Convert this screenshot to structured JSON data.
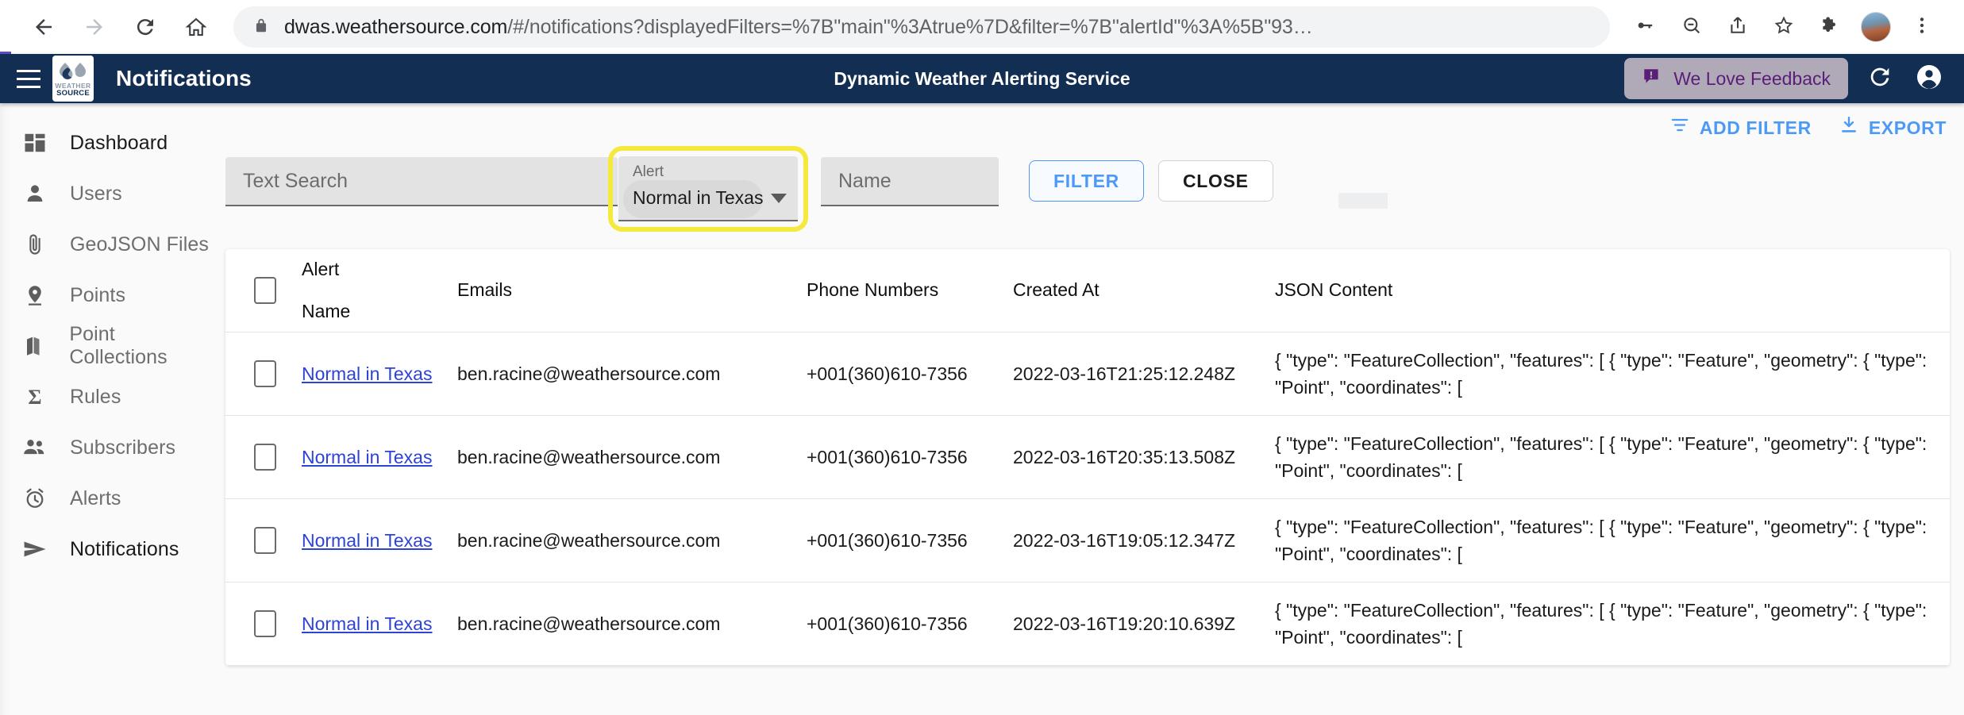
{
  "browser": {
    "url_prefix": "dwas.weathersource.com",
    "url_suffix": "/#/notifications?displayedFilters=%7B\"main\"%3Atrue%7D&filter=%7B\"alertId\"%3A%5B\"93…",
    "back_icon": "back-arrow-icon",
    "forward_icon": "forward-arrow-icon",
    "reload_icon": "reload-icon",
    "home_icon": "home-icon",
    "lock_icon": "lock-icon",
    "password_icon": "password-key-icon",
    "zoom_out_icon": "zoom-out-icon",
    "share_icon": "share-icon",
    "bookmark_icon": "star-icon",
    "extensions_icon": "puzzle-piece-icon",
    "menu_icon": "three-dot-menu-icon"
  },
  "header": {
    "menu_icon": "hamburger-menu-icon",
    "logo_line1": "WEATHER",
    "logo_line2": "SOURCE",
    "title": "Notifications",
    "center_title": "Dynamic Weather Alerting Service",
    "feedback_label": "We Love Feedback",
    "feedback_icon": "feedback-flag-icon",
    "refresh_icon": "refresh-icon",
    "account_icon": "account-circle-icon",
    "bg_color": "#122f53",
    "feedback_bg": "#b0aab8",
    "feedback_text_color": "#5a1d78"
  },
  "sidebar": {
    "items": [
      {
        "label": "Dashboard",
        "icon": "dashboard-grid-icon",
        "active": true
      },
      {
        "label": "Users",
        "icon": "person-icon",
        "active": false
      },
      {
        "label": "GeoJSON Files",
        "icon": "paperclip-icon",
        "active": false
      },
      {
        "label": "Points",
        "icon": "map-pin-icon",
        "active": false
      },
      {
        "label": "Point Collections",
        "icon": "map-folded-icon",
        "active": false
      },
      {
        "label": "Rules",
        "icon": "sigma-icon",
        "active": false
      },
      {
        "label": "Subscribers",
        "icon": "people-group-icon",
        "active": false
      },
      {
        "label": "Alerts",
        "icon": "alarm-clock-icon",
        "active": false
      },
      {
        "label": "Notifications",
        "icon": "send-paper-plane-icon",
        "active": true
      }
    ]
  },
  "toolbar": {
    "add_filter_label": "ADD FILTER",
    "add_filter_icon": "filter-list-icon",
    "export_label": "EXPORT",
    "export_icon": "download-icon",
    "accent_color": "#4d9af6"
  },
  "filters": {
    "text_search_placeholder": "Text Search",
    "alert_label": "Alert",
    "alert_value": "Normal in Texas",
    "alert_caret_icon": "chevron-down-icon",
    "name_placeholder": "Name",
    "filter_button": "FILTER",
    "close_button": "CLOSE",
    "highlight_color": "#f5e93e"
  },
  "table": {
    "columns": [
      {
        "key": "alert",
        "label_line1": "Alert",
        "label_line2": "Name"
      },
      {
        "key": "emails",
        "label": "Emails"
      },
      {
        "key": "phones",
        "label": "Phone Numbers"
      },
      {
        "key": "created",
        "label": "Created At"
      },
      {
        "key": "json",
        "label": "JSON Content"
      }
    ],
    "rows": [
      {
        "alert_name": "Normal in Texas",
        "email": "ben.racine@weathersource.com",
        "phone": "+001(360)610-7356",
        "created_at": "2022-03-16T21:25:12.248Z",
        "json_content": "{ \"type\": \"FeatureCollection\", \"features\": [ { \"type\": \"Feature\", \"geometry\": { \"type\": \"Point\", \"coordinates\": ["
      },
      {
        "alert_name": "Normal in Texas",
        "email": "ben.racine@weathersource.com",
        "phone": "+001(360)610-7356",
        "created_at": "2022-03-16T20:35:13.508Z",
        "json_content": "{ \"type\": \"FeatureCollection\", \"features\": [ { \"type\": \"Feature\", \"geometry\": { \"type\": \"Point\", \"coordinates\": ["
      },
      {
        "alert_name": "Normal in Texas",
        "email": "ben.racine@weathersource.com",
        "phone": "+001(360)610-7356",
        "created_at": "2022-03-16T19:05:12.347Z",
        "json_content": "{ \"type\": \"FeatureCollection\", \"features\": [ { \"type\": \"Feature\", \"geometry\": { \"type\": \"Point\", \"coordinates\": ["
      },
      {
        "alert_name": "Normal in Texas",
        "email": "ben.racine@weathersource.com",
        "phone": "+001(360)610-7356",
        "created_at": "2022-03-16T19:20:10.639Z",
        "json_content": "{ \"type\": \"FeatureCollection\", \"features\": [ { \"type\": \"Feature\", \"geometry\": { \"type\": \"Point\", \"coordinates\": ["
      }
    ]
  }
}
